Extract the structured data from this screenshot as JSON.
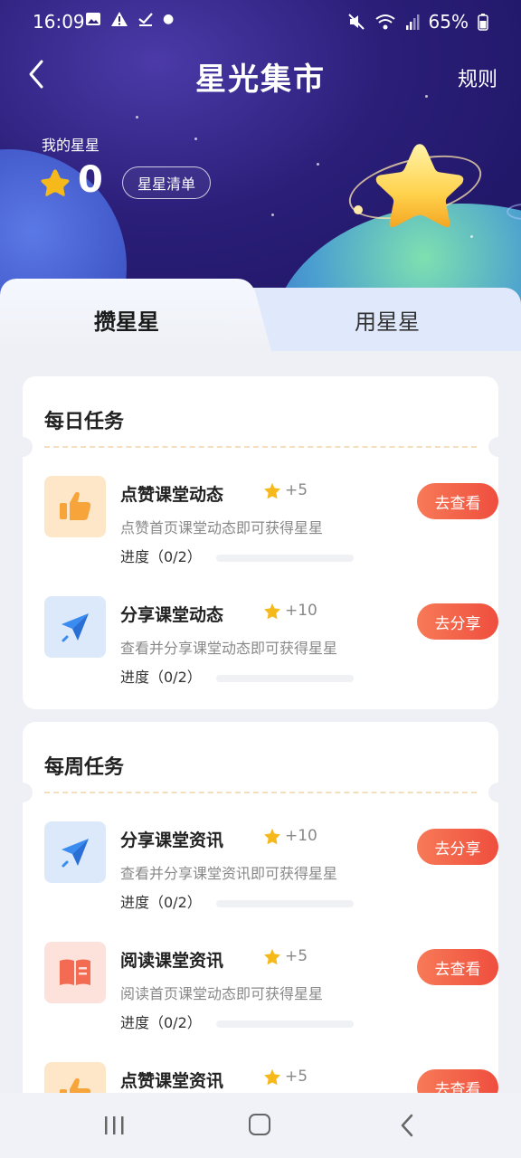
{
  "status": {
    "time": "16:09",
    "battery": "65%"
  },
  "header": {
    "title": "星光集市",
    "rules": "规则",
    "my_stars_label": "我的星星",
    "star_count": "0",
    "star_list_button": "星星清单"
  },
  "tabs": [
    {
      "label": "攒星星",
      "active": true
    },
    {
      "label": "用星星",
      "active": false
    }
  ],
  "daily": {
    "title": "每日任务",
    "tasks": [
      {
        "name": "点赞课堂动态",
        "reward": "+5",
        "desc": "点赞首页课堂动态即可获得星星",
        "progress": "进度（0/2）",
        "button": "去查看",
        "icon": "thumbs-up-icon"
      },
      {
        "name": "分享课堂动态",
        "reward": "+10",
        "desc": "查看并分享课堂动态即可获得星星",
        "progress": "进度（0/2）",
        "button": "去分享",
        "icon": "paper-plane-icon"
      }
    ]
  },
  "weekly": {
    "title": "每周任务",
    "tasks": [
      {
        "name": "分享课堂资讯",
        "reward": "+10",
        "desc": "查看并分享课堂资讯即可获得星星",
        "progress": "进度（0/2）",
        "button": "去分享",
        "icon": "paper-plane-icon"
      },
      {
        "name": "阅读课堂资讯",
        "reward": "+5",
        "desc": "阅读首页课堂动态即可获得星星",
        "progress": "进度（0/2）",
        "button": "去查看",
        "icon": "book-icon"
      },
      {
        "name": "点赞课堂资讯",
        "reward": "+5",
        "button": "去查看",
        "icon": "thumbs-up-icon"
      }
    ]
  },
  "colors": {
    "accent": "#ef4e3e",
    "hero": "#2a1e78",
    "star": "#f6b91c"
  }
}
